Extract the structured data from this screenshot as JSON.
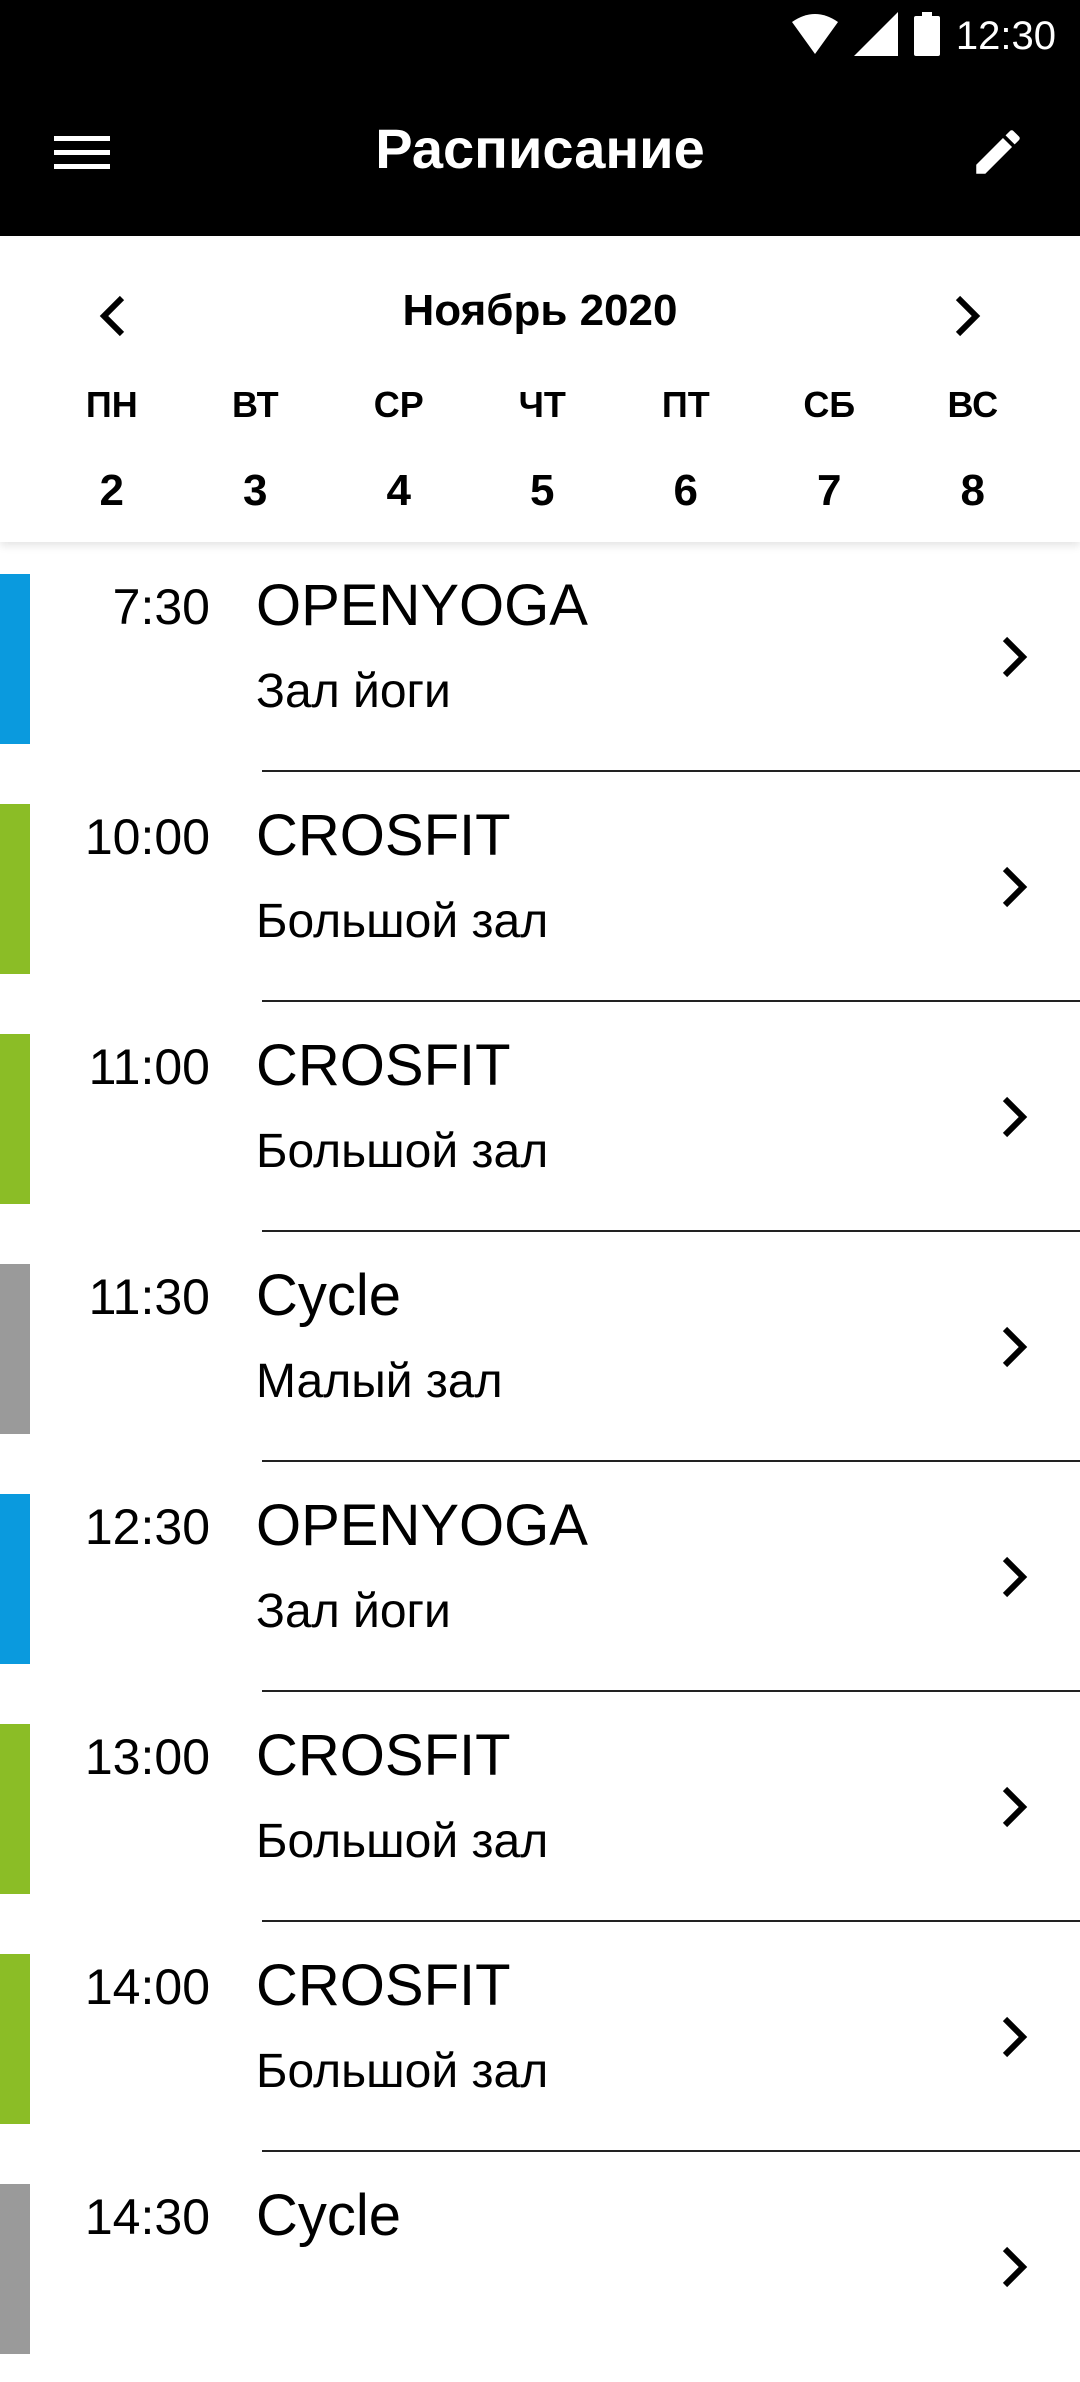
{
  "status_bar": {
    "time": "12:30",
    "icons": [
      "wifi-icon",
      "signal-icon",
      "battery-icon"
    ]
  },
  "app_bar": {
    "title": "Расписание",
    "left_icon": "menu-icon",
    "right_icon": "edit-icon"
  },
  "calendar": {
    "month": "Ноябрь 2020",
    "weekdays": [
      "ПН",
      "ВТ",
      "СР",
      "ЧТ",
      "ПТ",
      "СБ",
      "ВС"
    ],
    "dates": [
      "2",
      "3",
      "4",
      "5",
      "6",
      "7",
      "8"
    ]
  },
  "colors": {
    "yoga": "#0a9ade",
    "crossfit": "#8bbd26",
    "cycle": "#9a9a9a"
  },
  "schedule": [
    {
      "time": "7:30",
      "name": "OPENYOGA",
      "room": "Зал йоги",
      "category": "yoga"
    },
    {
      "time": "10:00",
      "name": "CROSFIT",
      "room": "Большой зал",
      "category": "crossfit"
    },
    {
      "time": "11:00",
      "name": "CROSFIT",
      "room": "Большой зал",
      "category": "crossfit"
    },
    {
      "time": "11:30",
      "name": "Cycle",
      "room": "Малый зал",
      "category": "cycle"
    },
    {
      "time": "12:30",
      "name": "OPENYOGA",
      "room": "Зал йоги",
      "category": "yoga"
    },
    {
      "time": "13:00",
      "name": "CROSFIT",
      "room": "Большой зал",
      "category": "crossfit"
    },
    {
      "time": "14:00",
      "name": "CROSFIT",
      "room": "Большой зал",
      "category": "crossfit"
    },
    {
      "time": "14:30",
      "name": "Cycle",
      "room": "",
      "category": "cycle"
    }
  ]
}
